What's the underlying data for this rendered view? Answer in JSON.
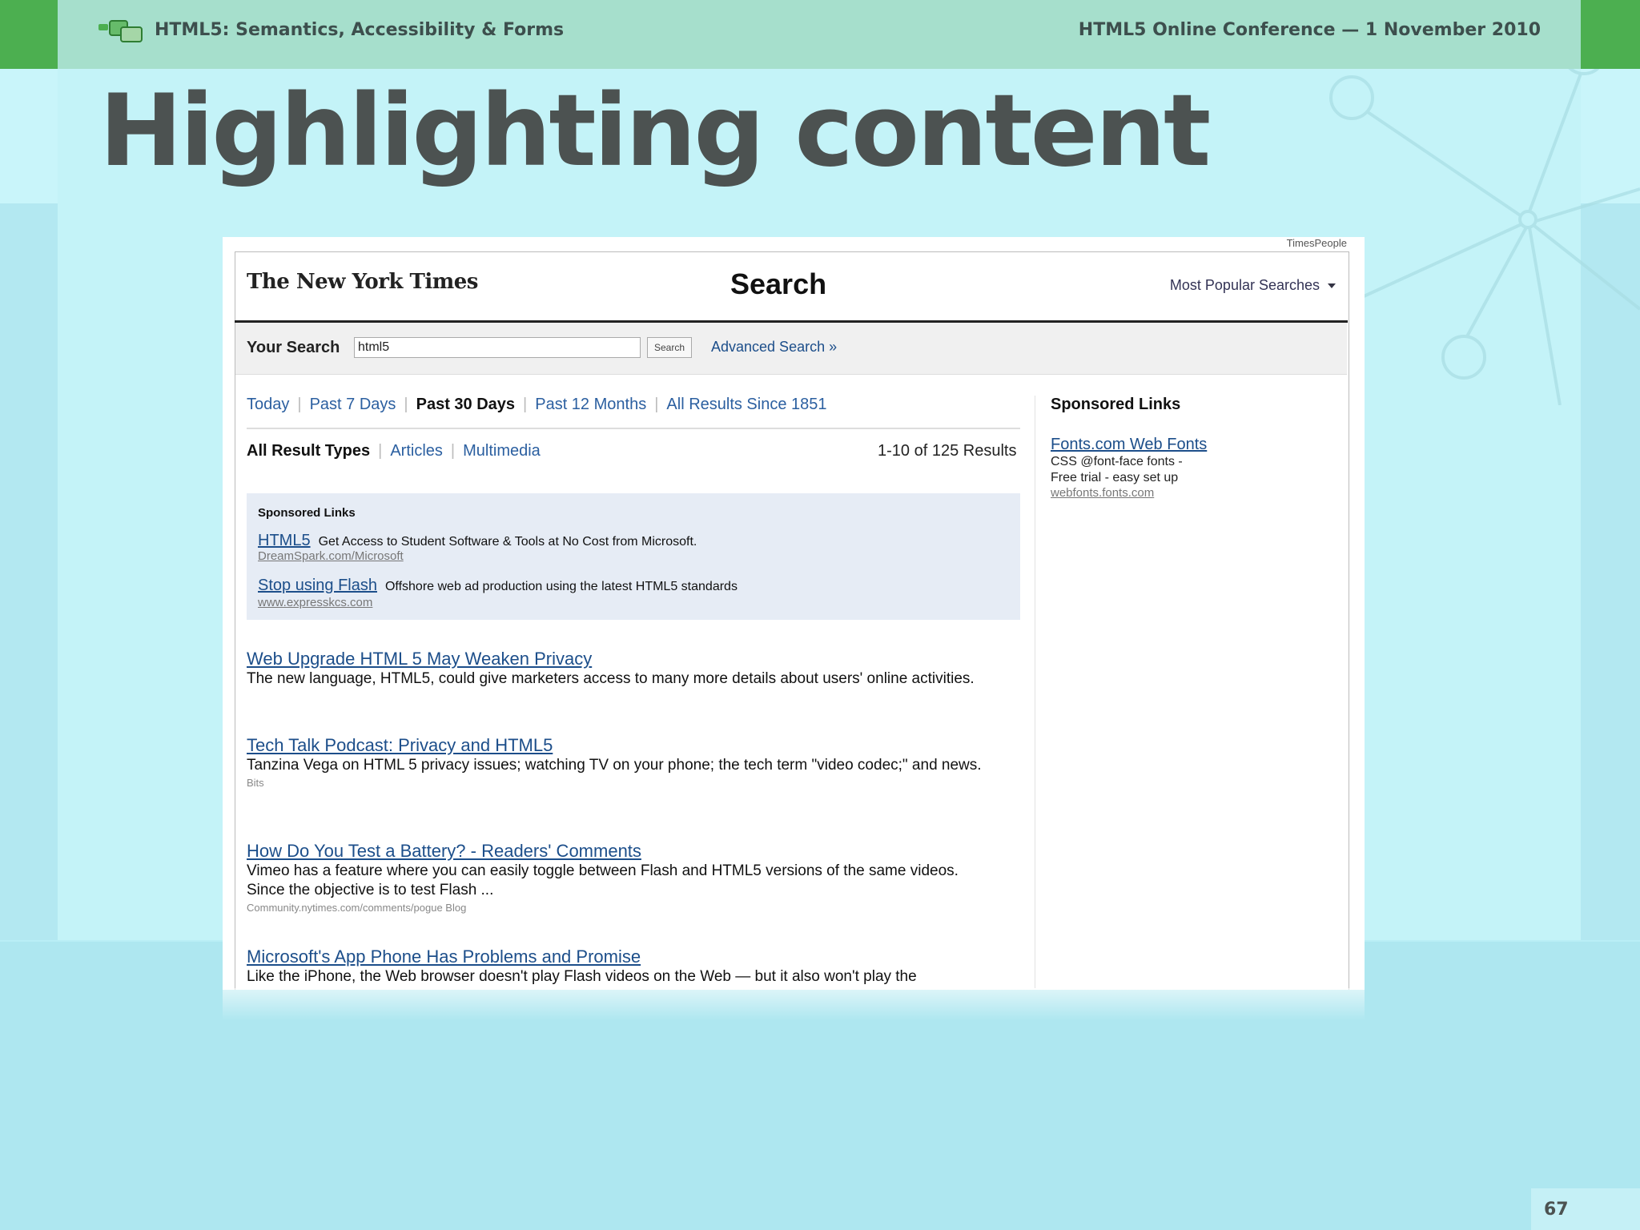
{
  "slide": {
    "header_left": "HTML5: Semantics, Accessibility & Forms",
    "header_right": "HTML5 Online Conference — 1 November 2010",
    "title": "Highlighting content",
    "page_number": "67"
  },
  "nyt": {
    "timespeople": "TimesPeople",
    "logo_text": "The New York Times",
    "page_title": "Search",
    "most_popular": "Most Popular Searches",
    "your_search_label": "Your Search",
    "search_value": "html5",
    "search_button": "Search",
    "advanced_search": "Advanced Search »",
    "date_filters": [
      {
        "label": "Today",
        "active": false
      },
      {
        "label": "Past 7 Days",
        "active": false
      },
      {
        "label": "Past 30 Days",
        "active": true
      },
      {
        "label": "Past 12 Months",
        "active": false
      },
      {
        "label": "All Results Since 1851",
        "active": false
      }
    ],
    "type_filters": [
      {
        "label": "All Result Types",
        "active": true
      },
      {
        "label": "Articles",
        "active": false
      },
      {
        "label": "Multimedia",
        "active": false
      }
    ],
    "results_count": "1-10 of 125 Results",
    "sponsored": {
      "title": "Sponsored Links",
      "items": [
        {
          "link": "HTML5",
          "text": "Get Access to Student Software & Tools at No Cost from Microsoft.",
          "url": "DreamSpark.com/Microsoft"
        },
        {
          "link": "Stop using Flash",
          "text": "Offshore web ad production using the latest HTML5 standards",
          "url": "www.expresskcs.com"
        }
      ]
    },
    "results": [
      {
        "title": "Web Upgrade HTML 5 May Weaken Privacy",
        "snippet": "The new language, HTML5, could give marketers access to many more details about users' online activities.",
        "source": ""
      },
      {
        "title": "Tech Talk Podcast: Privacy and HTML5",
        "snippet": "Tanzina Vega on HTML 5 privacy issues; watching TV on your phone; the tech term \"video codec;\" and news.",
        "source": "Bits"
      },
      {
        "title": "How Do You Test a Battery? - Readers' Comments",
        "snippet": "Vimeo has a feature where you can easily toggle between Flash and HTML5 versions of the same videos. Since the objective is to test Flash ...",
        "source": "Community.nytimes.com/comments/pogue Blog"
      },
      {
        "title": "Microsoft's App Phone Has Problems and Promise",
        "snippet": "Like the iPhone, the Web browser doesn't play Flash videos on the Web — but it also won't play the",
        "source": ""
      }
    ],
    "right_sponsored": {
      "title": "Sponsored Links",
      "link": "Fonts.com Web Fonts",
      "line1": "CSS @font-face fonts -",
      "line2": "Free trial - easy set up",
      "url": "webfonts.fonts.com"
    }
  }
}
